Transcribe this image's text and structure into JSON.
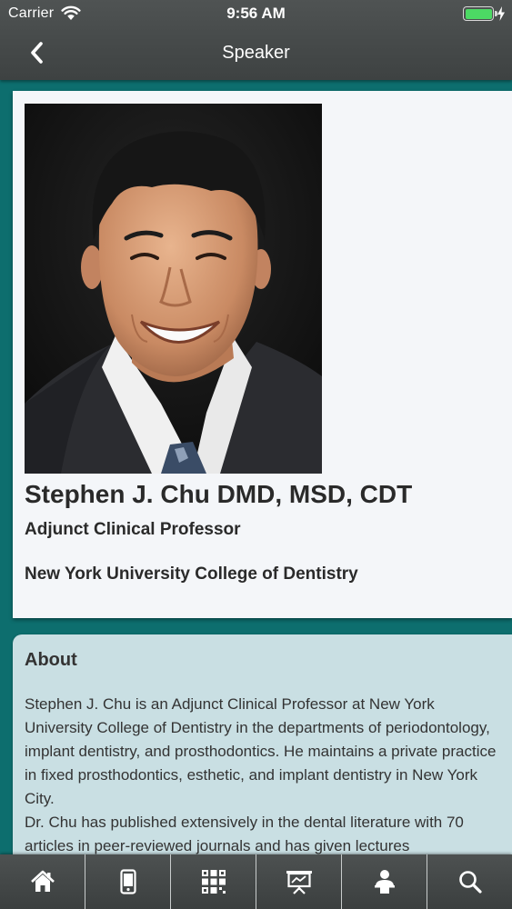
{
  "status_bar": {
    "carrier": "Carrier",
    "time": "9:56 AM",
    "battery_level": 1.0,
    "battery_color": "#4cd964"
  },
  "nav": {
    "back_icon": "chevron-left-icon",
    "title": "Speaker"
  },
  "speaker": {
    "name": "Stephen J. Chu DMD, MSD, CDT",
    "title": "Adjunct Clinical Professor",
    "organization": "New York University College of Dentistry"
  },
  "about": {
    "heading": "About",
    "paragraphs": [
      "Stephen J. Chu is an Adjunct Clinical Professor at New York University College of Dentistry in the departments of periodontology, implant dentistry, and prosthodontics. He maintains a private practice in fixed prosthodontics, esthetic, and implant dentistry in New York City.",
      "Dr. Chu has published extensively in the dental literature with 70 articles in peer-reviewed journals and has given lectures"
    ]
  },
  "tab_bar": {
    "tabs": [
      {
        "icon": "home-icon"
      },
      {
        "icon": "phone-icon"
      },
      {
        "icon": "qr-code-icon"
      },
      {
        "icon": "presentation-board-icon"
      },
      {
        "icon": "speaker-person-icon"
      },
      {
        "icon": "search-icon"
      }
    ]
  },
  "colors": {
    "background_teal": "#0d6e6e",
    "bar_gray": "#454949",
    "about_card": "#c9dfe3",
    "profile_card": "#f4f6f9"
  }
}
